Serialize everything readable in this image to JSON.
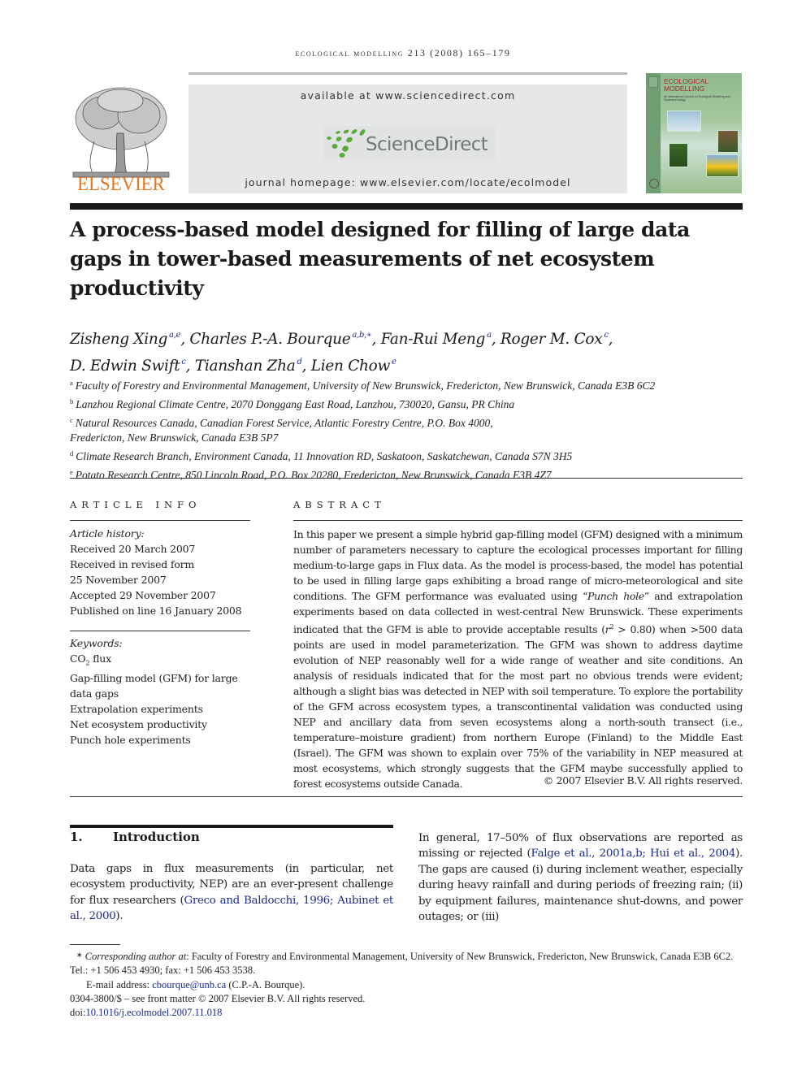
{
  "running_head": "ecological modelling 213 (2008) 165–179",
  "header": {
    "publisher_name": "ELSEVIER",
    "available_at": "available at www.sciencedirect.com",
    "sciencedirect_logo": "ScienceDirect",
    "journal_homepage": "journal homepage: www.elsevier.com/locate/ecolmodel",
    "cover": {
      "title_line1": "ECOLOGICAL",
      "title_line2": "MODELLING",
      "subtitle": "An International Journal on Ecological Modelling and Systems Ecology"
    },
    "colors": {
      "elsevier_orange": "#e87722",
      "sciencedirect_green": "#5aab3b",
      "link_blue": "#1a2a8a"
    }
  },
  "article": {
    "title": "A process-based model designed for filling of large data gaps in tower-based measurements of net ecosystem productivity",
    "authors": [
      {
        "name": "Zisheng Xing",
        "sup": "a,e",
        "sep": ", "
      },
      {
        "name": "Charles P.-A. Bourque",
        "sup": "a,b,∗",
        "sep": ", "
      },
      {
        "name": "Fan-Rui Meng",
        "sup": "a",
        "sep": ", "
      },
      {
        "name": "Roger M. Cox",
        "sup": "c",
        "sep": ","
      },
      {
        "name": "D. Edwin Swift",
        "sup": "c",
        "sep": ", "
      },
      {
        "name": "Tianshan Zha",
        "sup": "d",
        "sep": ", "
      },
      {
        "name": "Lien Chow",
        "sup": "e",
        "sep": ""
      }
    ],
    "affiliations": [
      {
        "key": "a",
        "text": "Faculty of Forestry and Environmental Management, University of New Brunswick, Fredericton, New Brunswick, Canada E3B 6C2"
      },
      {
        "key": "b",
        "text": "Lanzhou Regional Climate Centre, 2070 Donggang East Road, Lanzhou, 730020, Gansu, PR China"
      },
      {
        "key": "c",
        "text": "Natural Resources Canada, Canadian Forest Service, Atlantic Forestry Centre, P.O. Box 4000,"
      },
      {
        "key": "",
        "text": "Fredericton, New Brunswick, Canada E3B 5P7"
      },
      {
        "key": "d",
        "text": "Climate Research Branch, Environment Canada, 11 Innovation RD, Saskatoon, Saskatchewan, Canada S7N 3H5"
      },
      {
        "key": "e",
        "text": "Potato Research Centre, 850 Lincoln Road, P.O. Box 20280, Fredericton, New Brunswick, Canada E3B 4Z7"
      }
    ]
  },
  "article_info": {
    "heading": "ARTICLE INFO",
    "history_label": "Article history:",
    "history": [
      "Received 20 March 2007",
      "Received in revised form",
      "25 November 2007",
      "Accepted 29 November 2007",
      "Published on line 16 January 2008"
    ],
    "keywords_label": "Keywords:",
    "keywords": [
      {
        "text": "CO",
        "sub": "2",
        "after": " flux"
      },
      {
        "text": "Gap-filling model (GFM) for large"
      },
      {
        "text": "data gaps"
      },
      {
        "text": "Extrapolation experiments"
      },
      {
        "text": "Net ecosystem productivity"
      },
      {
        "text": "Punch hole experiments"
      }
    ]
  },
  "abstract": {
    "heading": "ABSTRACT",
    "part1": "In this paper we present a simple hybrid gap-filling model (GFM) designed with a minimum number of parameters necessary to capture the ecological processes important for filling medium-to-large gaps in Flux data. As the model is process-based, the model has potential to be used in filling large gaps exhibiting a broad range of micro-meteorological and site conditions. The GFM performance was evaluated using “",
    "part1_italic": "Punch hole",
    "part2": "” and extrapolation experiments based on data collected in west-central New Brunswick. These experiments indicated that the GFM is able to provide acceptable results (",
    "r_symbol": "r",
    "r_sup": "2",
    "part3": " > 0.80) when >500 data points are used in model parameterization. The GFM was shown to address daytime evolution of NEP reasonably well for a wide range of weather and site conditions. An analysis of residuals indicated that for the most part no obvious trends were evident; although a slight bias was detected in NEP with soil temperature. To explore the portability of the GFM across ecosystem types, a transcontinental validation was conducted using NEP and ancillary data from seven ecosystems along a north-south transect (i.e., temperature–moisture gradient) from northern Europe (Finland) to the Middle East (Israel). The GFM was shown to explain over 75% of the variability in NEP measured at most ecosystems, which strongly suggests that the GFM maybe successfully applied to forest ecosystems outside Canada.",
    "copyright": "© 2007 Elsevier B.V. All rights reserved."
  },
  "introduction": {
    "number": "1.",
    "heading": "Introduction",
    "left_text_before": "Data gaps in flux measurements (in particular, net ecosystem productivity, NEP) are an ever-present challenge for flux researchers (",
    "left_cite1": "Greco and Baldocchi, 1996",
    "left_cite_sep": "; ",
    "left_cite2": "Aubinet et al., 2000",
    "left_text_after": ").",
    "right_text_before": "In general, 17–50% of flux observations are reported as missing or rejected (",
    "right_cite1": "Falge et al., 2001a,b",
    "right_cite_sep": "; ",
    "right_cite2": "Hui et al., 2004",
    "right_text_after": "). The gaps are caused (i) during inclement weather, especially during heavy rainfall and during periods of freezing rain; (ii) by equipment failures, maintenance shut-downs, and power outages; or (iii)"
  },
  "footnotes": {
    "star": "∗",
    "corresponding_label": "Corresponding author at",
    "corresponding_text": ": Faculty of Forestry and Environmental Management, University of New Brunswick, Fredericton, New Brunswick, Canada E3B 6C2. Tel.: +1 506 453 4930; fax: +1 506 453 3538.",
    "email_label": "E-mail address: ",
    "email": "cbourque@unb.ca",
    "email_after": " (C.P.-A. Bourque).",
    "front_matter": "0304-3800/$ – see front matter © 2007 Elsevier B.V. All rights reserved.",
    "doi_label": "doi:",
    "doi": "10.1016/j.ecolmodel.2007.11.018"
  }
}
